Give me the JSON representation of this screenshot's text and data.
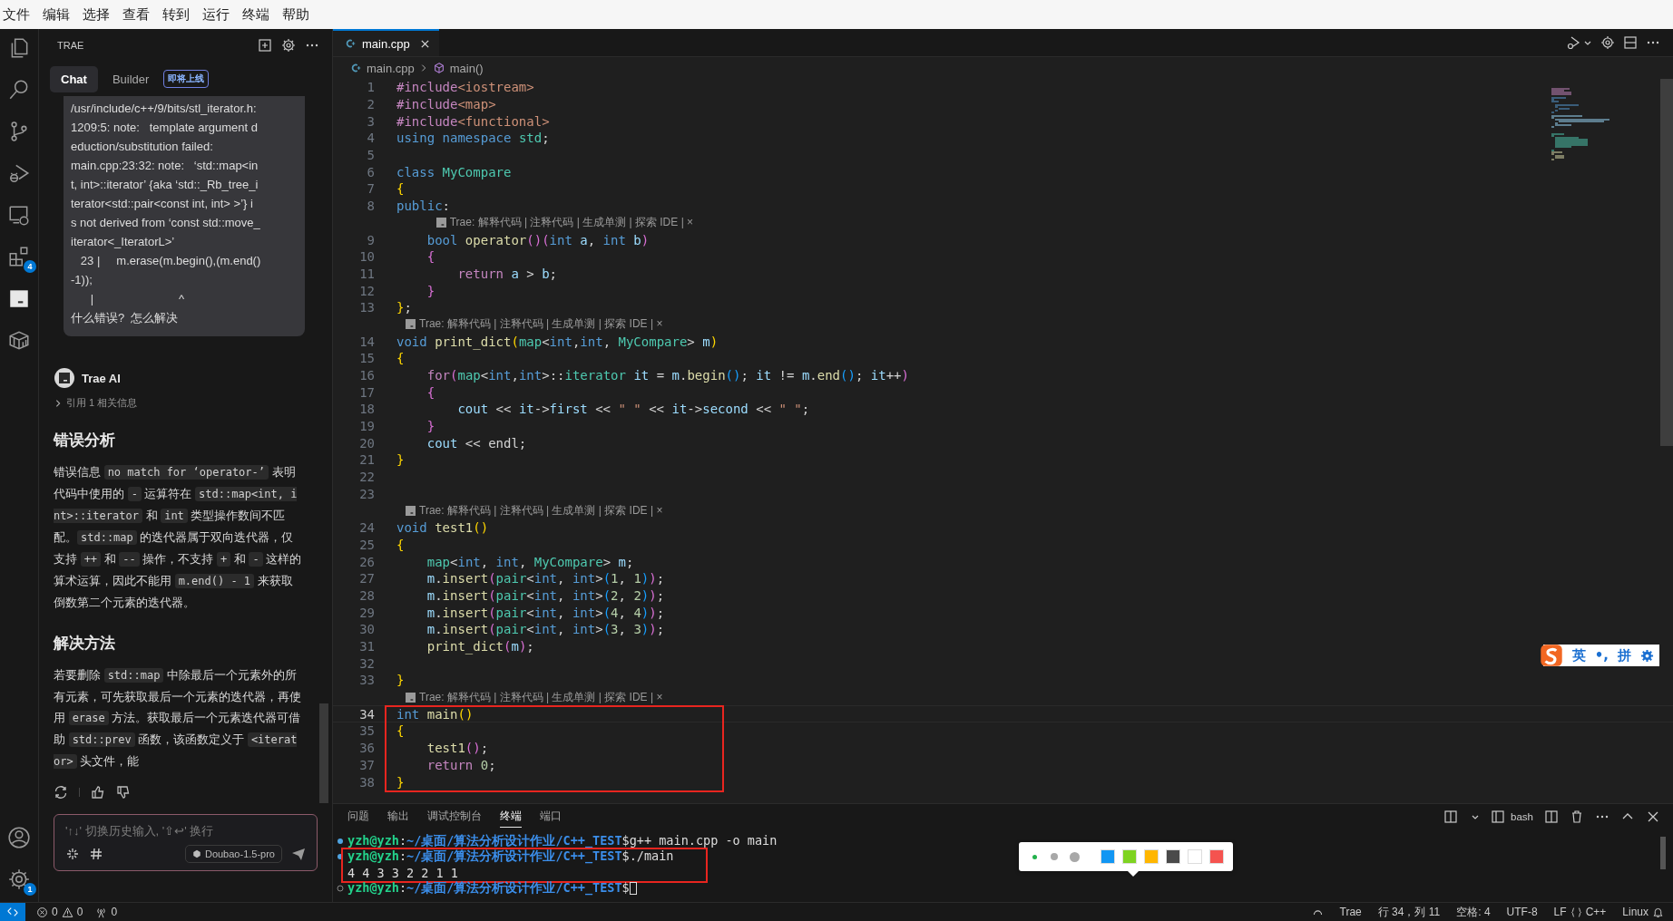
{
  "menu_bar": [
    "文件",
    "编辑",
    "选择",
    "查看",
    "转到",
    "运行",
    "终端",
    "帮助"
  ],
  "activity_bar": {
    "extensions_badge": "4",
    "settings_badge": "1"
  },
  "side_panel": {
    "title": "TRAE",
    "tabs": [
      {
        "label": "Chat",
        "selected": true
      },
      {
        "label": "Builder",
        "selected": false,
        "badge": "即将上线"
      }
    ],
    "user_message": [
      "/usr/include/c++/9/bits/stl_iterator.h:",
      "1209:5: note:   template argument d",
      "eduction/substitution failed:",
      "main.cpp:23:32: note:   ‘std::map<in",
      "t, int>::iterator’ {aka ‘std::_Rb_tree_i",
      "terator<std::pair<const int, int> >’} i",
      "s not derived from ‘const std::move_",
      "iterator<_IteratorL>’",
      "   23 |     m.erase(m.begin(),(m.end()",
      "-1));",
      "      |                          ^",
      "什么错误?  怎么解决"
    ],
    "assistant": {
      "name": "Trae AI",
      "reference": "引用 1 相关信息",
      "sections": [
        {
          "heading": "错误分析",
          "paragraph": [
            {
              "kind": "text",
              "text": "错误信息 "
            },
            {
              "kind": "code",
              "text": "no match for ‘operator-’"
            },
            {
              "kind": "text",
              "text": " 表明代码中使用的 "
            },
            {
              "kind": "code",
              "text": "-"
            },
            {
              "kind": "text",
              "text": " 运算符在 "
            },
            {
              "kind": "code",
              "text": "std::map<int, int>::iterator"
            },
            {
              "kind": "text",
              "text": " 和 "
            },
            {
              "kind": "code",
              "text": "int"
            },
            {
              "kind": "text",
              "text": " 类型操作数间不匹配。"
            },
            {
              "kind": "code",
              "text": "std::map"
            },
            {
              "kind": "text",
              "text": " 的迭代器属于双向迭代器，仅支持 "
            },
            {
              "kind": "code",
              "text": "++"
            },
            {
              "kind": "text",
              "text": " 和 "
            },
            {
              "kind": "code",
              "text": "--"
            },
            {
              "kind": "text",
              "text": " 操作，不支持 "
            },
            {
              "kind": "code",
              "text": "+"
            },
            {
              "kind": "text",
              "text": " 和 "
            },
            {
              "kind": "code",
              "text": "-"
            },
            {
              "kind": "text",
              "text": " 这样的算术运算，因此不能用 "
            },
            {
              "kind": "code",
              "text": "m.end() - 1"
            },
            {
              "kind": "text",
              "text": " 来获取倒数第二个元素的迭代器。"
            }
          ]
        },
        {
          "heading": "解决方法",
          "paragraph": [
            {
              "kind": "text",
              "text": "若要删除 "
            },
            {
              "kind": "code",
              "text": "std::map"
            },
            {
              "kind": "text",
              "text": " 中除最后一个元素外的所有元素，可先获取最后一个元素的迭代器，再使用 "
            },
            {
              "kind": "code",
              "text": "erase"
            },
            {
              "kind": "text",
              "text": " 方法。获取最后一个元素迭代器可借助 "
            },
            {
              "kind": "code",
              "text": "std::prev"
            },
            {
              "kind": "text",
              "text": " 函数，该函数定义于 "
            },
            {
              "kind": "code",
              "text": "<iterator>"
            },
            {
              "kind": "text",
              "text": " 头文件，能"
            }
          ]
        }
      ]
    },
    "input": {
      "placeholder": "'↑↓' 切换历史输入, '⇧↩' 换行",
      "model": "Doubao-1.5-pro"
    }
  },
  "editor": {
    "tab": {
      "label": "main.cpp"
    },
    "breadcrumb": [
      "main.cpp",
      "main()"
    ],
    "blocks": [
      {
        "marked": false,
        "rows": [
          {
            "kind": "code",
            "number": "1",
            "current": false,
            "tokens": [
              {
                "kind": "pp",
                "text": "#include"
              },
              {
                "kind": "hdr",
                "text": "<iostream>"
              }
            ]
          },
          {
            "kind": "code",
            "number": "2",
            "current": false,
            "tokens": [
              {
                "kind": "pp",
                "text": "#include"
              },
              {
                "kind": "hdr",
                "text": "<map>"
              }
            ]
          },
          {
            "kind": "code",
            "number": "3",
            "current": false,
            "tokens": [
              {
                "kind": "pp",
                "text": "#include"
              },
              {
                "kind": "hdr",
                "text": "<functional>"
              }
            ]
          },
          {
            "kind": "code",
            "number": "4",
            "current": false,
            "tokens": [
              {
                "kind": "kw",
                "text": "using"
              },
              {
                "kind": "kw",
                "text": " namespace"
              },
              {
                "kind": "type",
                "text": " std"
              },
              {
                "kind": "p",
                "text": ";"
              }
            ]
          },
          {
            "kind": "code",
            "number": "5",
            "current": false,
            "tokens": []
          },
          {
            "kind": "code",
            "number": "6",
            "current": false,
            "tokens": [
              {
                "kind": "kw",
                "text": "class"
              },
              {
                "kind": "type",
                "text": " MyCompare"
              }
            ]
          },
          {
            "kind": "code",
            "number": "7",
            "current": false,
            "tokens": [
              {
                "kind": "b1",
                "text": "{"
              }
            ]
          },
          {
            "kind": "code",
            "number": "8",
            "current": false,
            "tokens": [
              {
                "kind": "kw",
                "text": "public"
              },
              {
                "kind": "p",
                "text": ":"
              }
            ]
          },
          {
            "kind": "lens",
            "text": "Trae: 解释代码 | 注释代码 | 生成单测 | 探索 IDE | ×"
          },
          {
            "kind": "code",
            "number": "9",
            "current": false,
            "tokens": [
              {
                "kind": "kw",
                "text": "    bool"
              },
              {
                "kind": "fn",
                "text": " operator"
              },
              {
                "kind": "b2",
                "text": "()("
              },
              {
                "kind": "kw",
                "text": "int"
              },
              {
                "kind": "var",
                "text": " a"
              },
              {
                "kind": "p",
                "text": ", "
              },
              {
                "kind": "kw",
                "text": "int"
              },
              {
                "kind": "var",
                "text": " b"
              },
              {
                "kind": "b2",
                "text": ")"
              }
            ]
          },
          {
            "kind": "code",
            "number": "10",
            "current": false,
            "tokens": [
              {
                "kind": "b2",
                "text": "    {"
              }
            ]
          },
          {
            "kind": "code",
            "number": "11",
            "current": false,
            "tokens": [
              {
                "kind": "ctl",
                "text": "        return"
              },
              {
                "kind": "var",
                "text": " a"
              },
              {
                "kind": "p",
                "text": " > "
              },
              {
                "kind": "var",
                "text": "b"
              },
              {
                "kind": "p",
                "text": ";"
              }
            ]
          },
          {
            "kind": "code",
            "number": "12",
            "current": false,
            "tokens": [
              {
                "kind": "b2",
                "text": "    }"
              }
            ]
          },
          {
            "kind": "code",
            "number": "13",
            "current": false,
            "tokens": [
              {
                "kind": "b1",
                "text": "}"
              },
              {
                "kind": "p",
                "text": ";"
              }
            ]
          },
          {
            "kind": "lens",
            "text": "Trae: 解释代码 | 注释代码 | 生成单测 | 探索 IDE | ×"
          },
          {
            "kind": "code",
            "number": "14",
            "current": false,
            "tokens": [
              {
                "kind": "kw",
                "text": "void"
              },
              {
                "kind": "fn",
                "text": " print_dict"
              },
              {
                "kind": "b1",
                "text": "("
              },
              {
                "kind": "type",
                "text": "map"
              },
              {
                "kind": "p",
                "text": "<"
              },
              {
                "kind": "kw",
                "text": "int"
              },
              {
                "kind": "p",
                "text": ","
              },
              {
                "kind": "kw",
                "text": "int"
              },
              {
                "kind": "p",
                "text": ", "
              },
              {
                "kind": "type",
                "text": "MyCompare"
              },
              {
                "kind": "p",
                "text": "> "
              },
              {
                "kind": "var",
                "text": "m"
              },
              {
                "kind": "b1",
                "text": ")"
              }
            ]
          },
          {
            "kind": "code",
            "number": "15",
            "current": false,
            "tokens": [
              {
                "kind": "b1",
                "text": "{"
              }
            ]
          },
          {
            "kind": "code",
            "number": "16",
            "current": false,
            "tokens": [
              {
                "kind": "ctl",
                "text": "    for"
              },
              {
                "kind": "b2",
                "text": "("
              },
              {
                "kind": "type",
                "text": "map"
              },
              {
                "kind": "p",
                "text": "<"
              },
              {
                "kind": "kw",
                "text": "int"
              },
              {
                "kind": "p",
                "text": ","
              },
              {
                "kind": "kw",
                "text": "int"
              },
              {
                "kind": "p",
                "text": ">::"
              },
              {
                "kind": "type",
                "text": "iterator"
              },
              {
                "kind": "var",
                "text": " it"
              },
              {
                "kind": "p",
                "text": " = "
              },
              {
                "kind": "var",
                "text": "m"
              },
              {
                "kind": "p",
                "text": "."
              },
              {
                "kind": "fn",
                "text": "begin"
              },
              {
                "kind": "b3",
                "text": "()"
              },
              {
                "kind": "p",
                "text": "; "
              },
              {
                "kind": "var",
                "text": "it"
              },
              {
                "kind": "p",
                "text": " != "
              },
              {
                "kind": "var",
                "text": "m"
              },
              {
                "kind": "p",
                "text": "."
              },
              {
                "kind": "fn",
                "text": "end"
              },
              {
                "kind": "b3",
                "text": "()"
              },
              {
                "kind": "p",
                "text": "; "
              },
              {
                "kind": "var",
                "text": "it"
              },
              {
                "kind": "p",
                "text": "++"
              },
              {
                "kind": "b2",
                "text": ")"
              }
            ]
          },
          {
            "kind": "code",
            "number": "17",
            "current": false,
            "tokens": [
              {
                "kind": "b2",
                "text": "    {"
              }
            ]
          },
          {
            "kind": "code",
            "number": "18",
            "current": false,
            "tokens": [
              {
                "kind": "var",
                "text": "        cout"
              },
              {
                "kind": "p",
                "text": " << "
              },
              {
                "kind": "var",
                "text": "it"
              },
              {
                "kind": "p",
                "text": "->"
              },
              {
                "kind": "var",
                "text": "first"
              },
              {
                "kind": "p",
                "text": " << "
              },
              {
                "kind": "str",
                "text": "\" \""
              },
              {
                "kind": "p",
                "text": " << "
              },
              {
                "kind": "var",
                "text": "it"
              },
              {
                "kind": "p",
                "text": "->"
              },
              {
                "kind": "var",
                "text": "second"
              },
              {
                "kind": "p",
                "text": " << "
              },
              {
                "kind": "str",
                "text": "\" \""
              },
              {
                "kind": "p",
                "text": ";"
              }
            ]
          },
          {
            "kind": "code",
            "number": "19",
            "current": false,
            "tokens": [
              {
                "kind": "b2",
                "text": "    }"
              }
            ]
          },
          {
            "kind": "code",
            "number": "20",
            "current": false,
            "tokens": [
              {
                "kind": "var",
                "text": "    cout"
              },
              {
                "kind": "p",
                "text": " << endl;"
              }
            ]
          },
          {
            "kind": "code",
            "number": "21",
            "current": false,
            "tokens": [
              {
                "kind": "b1",
                "text": "}"
              }
            ]
          },
          {
            "kind": "code",
            "number": "22",
            "current": false,
            "tokens": []
          },
          {
            "kind": "code",
            "number": "23",
            "current": false,
            "tokens": []
          },
          {
            "kind": "lens",
            "text": "Trae: 解释代码 | 注释代码 | 生成单测 | 探索 IDE | ×"
          },
          {
            "kind": "code",
            "number": "24",
            "current": false,
            "tokens": [
              {
                "kind": "kw",
                "text": "void"
              },
              {
                "kind": "fn",
                "text": " test1"
              },
              {
                "kind": "b1",
                "text": "()"
              }
            ]
          },
          {
            "kind": "code",
            "number": "25",
            "current": false,
            "tokens": [
              {
                "kind": "b1",
                "text": "{"
              }
            ]
          },
          {
            "kind": "code",
            "number": "26",
            "current": false,
            "tokens": [
              {
                "kind": "type",
                "text": "    map"
              },
              {
                "kind": "p",
                "text": "<"
              },
              {
                "kind": "kw",
                "text": "int"
              },
              {
                "kind": "p",
                "text": ", "
              },
              {
                "kind": "kw",
                "text": "int"
              },
              {
                "kind": "p",
                "text": ", "
              },
              {
                "kind": "type",
                "text": "MyCompare"
              },
              {
                "kind": "p",
                "text": "> "
              },
              {
                "kind": "var",
                "text": "m"
              },
              {
                "kind": "p",
                "text": ";"
              }
            ]
          },
          {
            "kind": "code",
            "number": "27",
            "current": false,
            "tokens": [
              {
                "kind": "var",
                "text": "    m"
              },
              {
                "kind": "p",
                "text": "."
              },
              {
                "kind": "fn",
                "text": "insert"
              },
              {
                "kind": "b2",
                "text": "("
              },
              {
                "kind": "type",
                "text": "pair"
              },
              {
                "kind": "p",
                "text": "<"
              },
              {
                "kind": "kw",
                "text": "int"
              },
              {
                "kind": "p",
                "text": ", "
              },
              {
                "kind": "kw",
                "text": "int"
              },
              {
                "kind": "p",
                "text": ">"
              },
              {
                "kind": "b3",
                "text": "("
              },
              {
                "kind": "num",
                "text": "1"
              },
              {
                "kind": "p",
                "text": ", "
              },
              {
                "kind": "num",
                "text": "1"
              },
              {
                "kind": "b3",
                "text": ")"
              },
              {
                "kind": "b2",
                "text": ")"
              },
              {
                "kind": "p",
                "text": ";"
              }
            ]
          },
          {
            "kind": "code",
            "number": "28",
            "current": false,
            "tokens": [
              {
                "kind": "var",
                "text": "    m"
              },
              {
                "kind": "p",
                "text": "."
              },
              {
                "kind": "fn",
                "text": "insert"
              },
              {
                "kind": "b2",
                "text": "("
              },
              {
                "kind": "type",
                "text": "pair"
              },
              {
                "kind": "p",
                "text": "<"
              },
              {
                "kind": "kw",
                "text": "int"
              },
              {
                "kind": "p",
                "text": ", "
              },
              {
                "kind": "kw",
                "text": "int"
              },
              {
                "kind": "p",
                "text": ">"
              },
              {
                "kind": "b3",
                "text": "("
              },
              {
                "kind": "num",
                "text": "2"
              },
              {
                "kind": "p",
                "text": ", "
              },
              {
                "kind": "num",
                "text": "2"
              },
              {
                "kind": "b3",
                "text": ")"
              },
              {
                "kind": "b2",
                "text": ")"
              },
              {
                "kind": "p",
                "text": ";"
              }
            ]
          },
          {
            "kind": "code",
            "number": "29",
            "current": false,
            "tokens": [
              {
                "kind": "var",
                "text": "    m"
              },
              {
                "kind": "p",
                "text": "."
              },
              {
                "kind": "fn",
                "text": "insert"
              },
              {
                "kind": "b2",
                "text": "("
              },
              {
                "kind": "type",
                "text": "pair"
              },
              {
                "kind": "p",
                "text": "<"
              },
              {
                "kind": "kw",
                "text": "int"
              },
              {
                "kind": "p",
                "text": ", "
              },
              {
                "kind": "kw",
                "text": "int"
              },
              {
                "kind": "p",
                "text": ">"
              },
              {
                "kind": "b3",
                "text": "("
              },
              {
                "kind": "num",
                "text": "4"
              },
              {
                "kind": "p",
                "text": ", "
              },
              {
                "kind": "num",
                "text": "4"
              },
              {
                "kind": "b3",
                "text": ")"
              },
              {
                "kind": "b2",
                "text": ")"
              },
              {
                "kind": "p",
                "text": ";"
              }
            ]
          },
          {
            "kind": "code",
            "number": "30",
            "current": false,
            "tokens": [
              {
                "kind": "var",
                "text": "    m"
              },
              {
                "kind": "p",
                "text": "."
              },
              {
                "kind": "fn",
                "text": "insert"
              },
              {
                "kind": "b2",
                "text": "("
              },
              {
                "kind": "type",
                "text": "pair"
              },
              {
                "kind": "p",
                "text": "<"
              },
              {
                "kind": "kw",
                "text": "int"
              },
              {
                "kind": "p",
                "text": ", "
              },
              {
                "kind": "kw",
                "text": "int"
              },
              {
                "kind": "p",
                "text": ">"
              },
              {
                "kind": "b3",
                "text": "("
              },
              {
                "kind": "num",
                "text": "3"
              },
              {
                "kind": "p",
                "text": ", "
              },
              {
                "kind": "num",
                "text": "3"
              },
              {
                "kind": "b3",
                "text": ")"
              },
              {
                "kind": "b2",
                "text": ")"
              },
              {
                "kind": "p",
                "text": ";"
              }
            ]
          },
          {
            "kind": "code",
            "number": "31",
            "current": false,
            "tokens": [
              {
                "kind": "fn",
                "text": "    print_dict"
              },
              {
                "kind": "b2",
                "text": "("
              },
              {
                "kind": "var",
                "text": "m"
              },
              {
                "kind": "b2",
                "text": ")"
              },
              {
                "kind": "p",
                "text": ";"
              }
            ]
          },
          {
            "kind": "code",
            "number": "32",
            "current": false,
            "tokens": []
          },
          {
            "kind": "code",
            "number": "33",
            "current": false,
            "tokens": [
              {
                "kind": "b1",
                "text": "}"
              }
            ]
          },
          {
            "kind": "lens",
            "text": "Trae: 解释代码 | 注释代码 | 生成单测 | 探索 IDE | ×"
          }
        ]
      },
      {
        "marked": true,
        "rows": [
          {
            "kind": "code",
            "number": "34",
            "current": true,
            "tokens": [
              {
                "kind": "kw",
                "text": "int"
              },
              {
                "kind": "fn",
                "text": " main"
              },
              {
                "kind": "b1",
                "text": "()"
              }
            ]
          },
          {
            "kind": "code",
            "number": "35",
            "current": false,
            "tokens": [
              {
                "kind": "b1",
                "text": "{"
              }
            ]
          },
          {
            "kind": "code",
            "number": "36",
            "current": false,
            "tokens": [
              {
                "kind": "fn",
                "text": "    test1"
              },
              {
                "kind": "b2",
                "text": "()"
              },
              {
                "kind": "p",
                "text": ";"
              }
            ]
          },
          {
            "kind": "code",
            "number": "37",
            "current": false,
            "tokens": [
              {
                "kind": "ctl",
                "text": "    return"
              },
              {
                "kind": "num",
                "text": " 0"
              },
              {
                "kind": "p",
                "text": ";"
              }
            ]
          },
          {
            "kind": "code",
            "number": "38",
            "current": false,
            "tokens": [
              {
                "kind": "b1",
                "text": "}"
              }
            ]
          }
        ]
      }
    ]
  },
  "ime": {
    "mode": "英",
    "punctuation": "•,",
    "layout": "拼"
  },
  "panel": {
    "tabs": [
      {
        "label": "问题",
        "selected": false
      },
      {
        "label": "输出",
        "selected": false
      },
      {
        "label": "调试控制台",
        "selected": false
      },
      {
        "label": "终端",
        "selected": true
      },
      {
        "label": "端口",
        "selected": false
      }
    ],
    "shell": "bash",
    "blocks": [
      {
        "marked": false,
        "lines": [
          {
            "kind": "prompt",
            "finished": true,
            "user": "yzh@yzh",
            "separator": ":",
            "cwd": "~/桌面/算法分析设计作业/C++_TEST",
            "symbol": "$",
            "command": "g++ main.cpp -o main"
          }
        ]
      },
      {
        "marked": true,
        "lines": [
          {
            "kind": "prompt",
            "finished": true,
            "user": "yzh@yzh",
            "separator": ":",
            "cwd": "~/桌面/算法分析设计作业/C++_TEST",
            "symbol": "$",
            "command": "./main"
          },
          {
            "kind": "output",
            "text": "4 4 3 3 2 2 1 1"
          }
        ]
      },
      {
        "marked": false,
        "lines": [
          {
            "kind": "prompt",
            "finished": false,
            "user": "yzh@yzh",
            "separator": ":",
            "cwd": "~/桌面/算法分析设计作业/C++_TEST",
            "symbol": "$"
          }
        ]
      }
    ]
  },
  "color_toolbar": {
    "sizes": [
      {
        "selected": true
      },
      {
        "selected": false
      },
      {
        "selected": false
      }
    ],
    "colors": [
      {
        "color": "#1296f3"
      },
      {
        "color": "#7ed321"
      },
      {
        "color": "#ffb600"
      },
      {
        "color": "#4a4a4a"
      },
      {
        "color": "#ffffff"
      },
      {
        "color": "#f5534f"
      }
    ]
  },
  "status_bar": {
    "errors": "0",
    "warnings": "0",
    "ports": "0",
    "agent": "Trae",
    "cursor": "行 34，列 11",
    "indentation": "空格: 4",
    "encoding": "UTF-8",
    "eol": "LF",
    "language": "C++",
    "os": "Linux"
  }
}
